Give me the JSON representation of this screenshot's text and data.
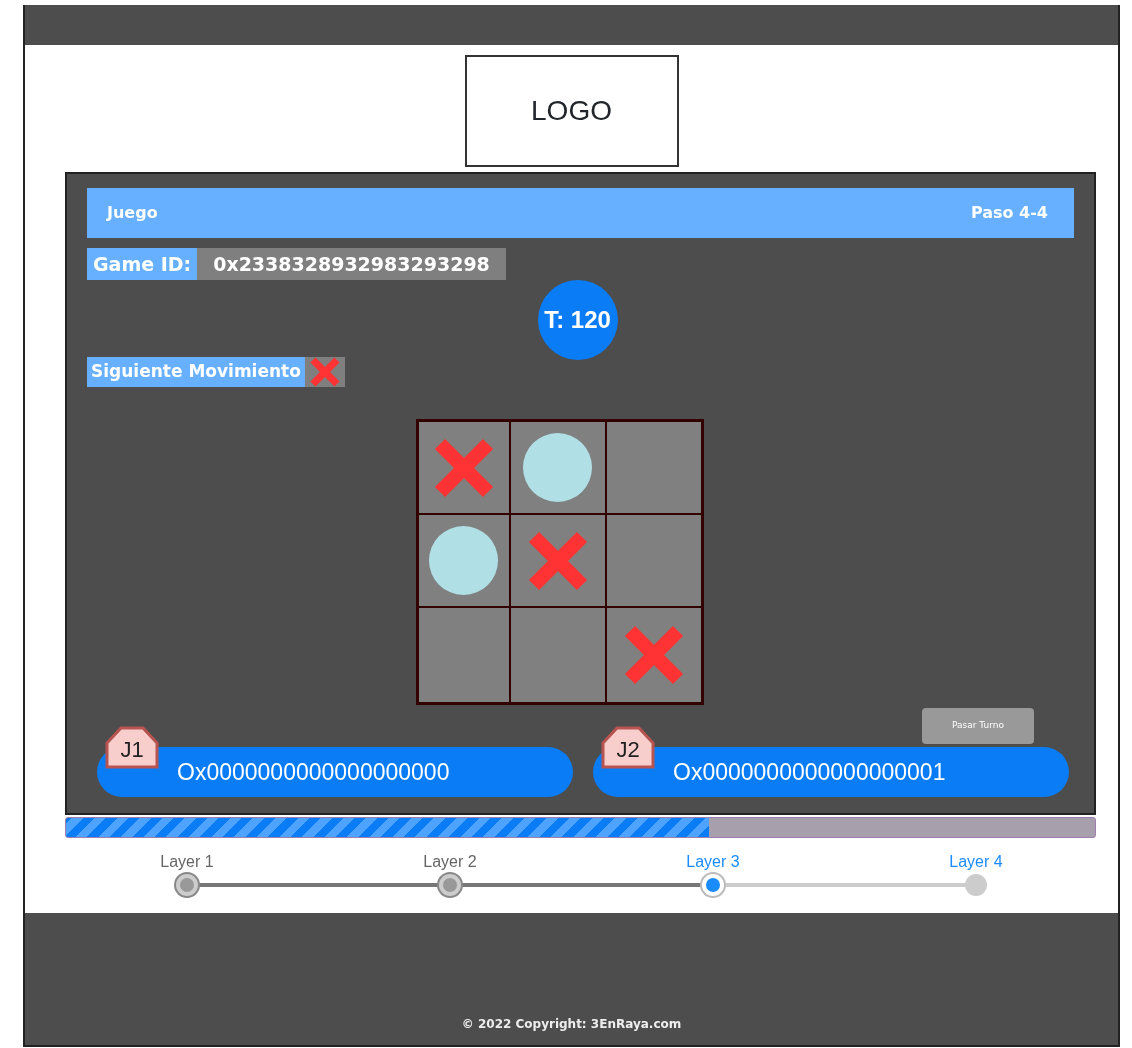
{
  "logo": "LOGO",
  "game": {
    "title": "Juego",
    "step": "Paso 4-4",
    "id_label": "Game ID:",
    "id_value": "0x2338328932983293298",
    "timer": "T: 120",
    "next_label": "Siguiente Movimiento",
    "next_mark": {
      "kind": "x"
    },
    "board": [
      [
        {
          "kind": "x"
        },
        {
          "kind": "o"
        },
        {
          "kind": "empty"
        }
      ],
      [
        {
          "kind": "o"
        },
        {
          "kind": "x"
        },
        {
          "kind": "empty"
        }
      ],
      [
        {
          "kind": "empty"
        },
        {
          "kind": "empty"
        },
        {
          "kind": "x"
        }
      ]
    ],
    "pass_button": "Pasar Turno",
    "players": [
      {
        "badge": "J1",
        "address": "Ox0000000000000000000"
      },
      {
        "badge": "J2",
        "address": "Ox0000000000000000001"
      }
    ]
  },
  "progress": {
    "level": 0.625
  },
  "steps": [
    {
      "label": "Layer 1",
      "completed": true,
      "selected": false
    },
    {
      "label": "Layer 2",
      "completed": true,
      "selected": false
    },
    {
      "label": "Layer 3",
      "completed": false,
      "selected": true
    },
    {
      "label": "Layer 4",
      "completed": false,
      "selected": false
    }
  ],
  "footer": "© 2022 Copyright: 3EnRaya.com"
}
